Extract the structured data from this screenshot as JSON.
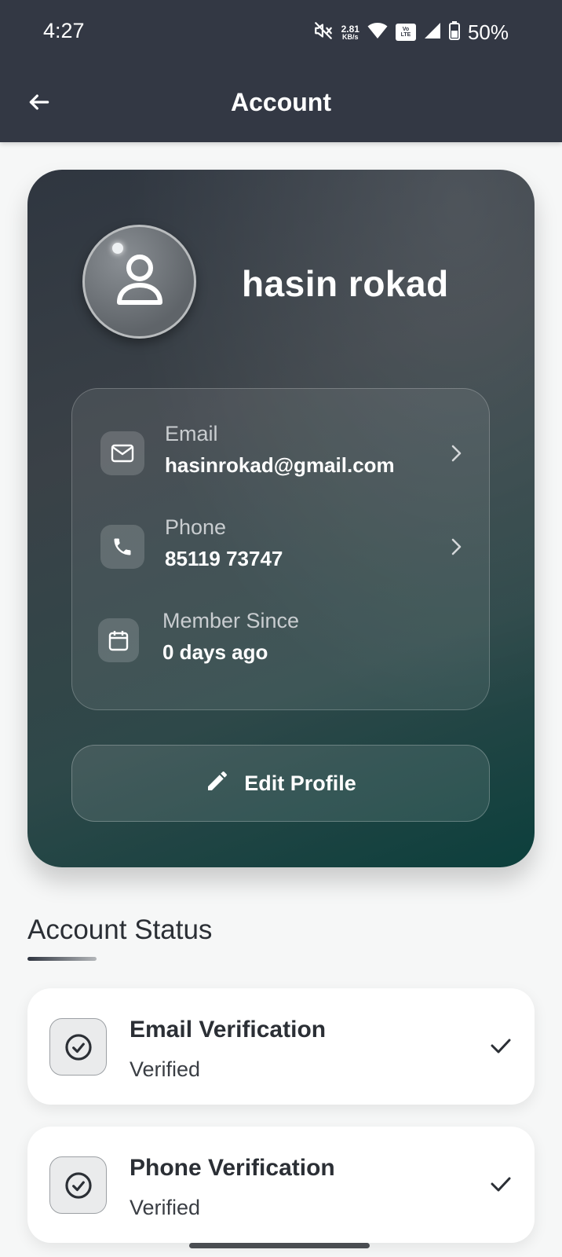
{
  "status_bar": {
    "time": "4:27",
    "net_speed_value": "2.81",
    "net_speed_unit": "KB/s",
    "volte_top": "Vo",
    "volte_bottom": "LTE",
    "battery": "50%",
    "icons": [
      "mute-icon",
      "wifi-icon",
      "volte-icon",
      "signal-icon",
      "battery-icon"
    ]
  },
  "header": {
    "title": "Account",
    "back_icon": "back-arrow-icon"
  },
  "profile": {
    "name": "hasin rokad",
    "avatar_icon": "user-icon",
    "rows": [
      {
        "label": "Email",
        "value": "hasinrokad@gmail.com",
        "icon": "mail-icon",
        "chevron": true
      },
      {
        "label": "Phone",
        "value": "85119 73747",
        "icon": "phone-icon",
        "chevron": true
      },
      {
        "label": "Member Since",
        "value": "0 days ago",
        "icon": "calendar-icon",
        "chevron": false
      }
    ],
    "edit_label": "Edit Profile",
    "edit_icon": "pencil-icon"
  },
  "account_status": {
    "title": "Account Status",
    "items": [
      {
        "title": "Email Verification",
        "status": "Verified",
        "icon": "check-circle-icon"
      },
      {
        "title": "Phone Verification",
        "status": "Verified",
        "icon": "check-circle-icon"
      }
    ]
  },
  "colors": {
    "topbar": "#333844",
    "card_gradient_start": "#2f3640",
    "card_gradient_end": "#0c3f3c",
    "page_background": "#f6f7f7"
  }
}
